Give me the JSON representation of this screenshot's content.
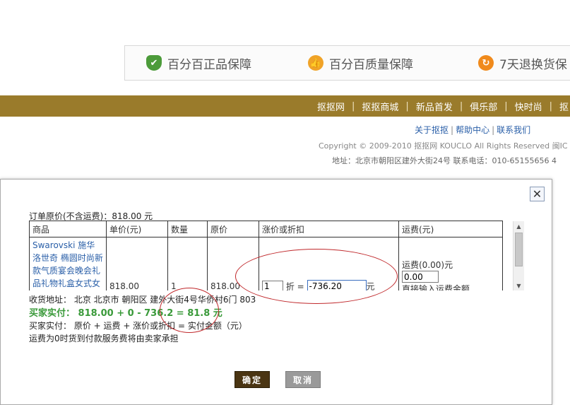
{
  "guarantees": [
    {
      "icon": "shield-check-icon",
      "glyph": "✔",
      "text": "百分百正品保障"
    },
    {
      "icon": "thumbs-up-icon",
      "glyph": "👍",
      "text": "百分百质量保障"
    },
    {
      "icon": "refresh-icon",
      "glyph": "↻",
      "text": "7天退换货保"
    }
  ],
  "nav": {
    "items": [
      "抠抠网",
      "抠抠商城",
      "新品首发",
      "俱乐部",
      "快时尚",
      "抠"
    ]
  },
  "footer": {
    "links": [
      "关于抠抠",
      "帮助中心",
      "联系我们"
    ],
    "copyright": "Copyright © 2009-2010 抠抠网 KOUCLO All Rights Reserved 闽IC",
    "address": "地址：北京市朝阳区建外大街24号 联系电话：010-65155656 4"
  },
  "dialog": {
    "close": "✕",
    "original_total": "订单原价(不含运费)：818.00 元",
    "table": {
      "headers": [
        "商品",
        "单价(元)",
        "数量",
        "原价",
        "涨价或折扣",
        "运费(元)"
      ],
      "row": {
        "product": "Swarovski 施华洛世奇 椭圆时尚新款气质宴会晚会礼品礼物礼盒女式女",
        "unit_price": "818.00",
        "quantity": "1",
        "original_price": "818.00",
        "discount_value": "1",
        "discount_label": "折 =",
        "adjusted_price": "-736.20",
        "yuan": "元",
        "shipping_label": "运费(0.00)元",
        "shipping_value": "0.00",
        "shipping_hint": "直接输入运费金额"
      }
    },
    "address_line": "收货地址：  北京 北京市 朝阳区 建外大街4号华侨村6门 803",
    "buyer_pay": "买家实付：  818.00 + 0 - 736.2 = 81.8 元",
    "formula": "买家实付：  原价 + 运费 + 涨价或折扣 = 实付金额（元）",
    "note": "运费为0时货到付款服务费将由卖家承担",
    "ok_label": "确定",
    "cancel_label": "取消"
  }
}
